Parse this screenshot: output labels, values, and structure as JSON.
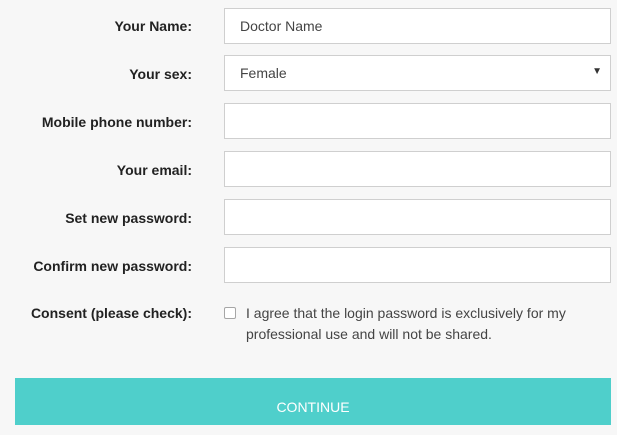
{
  "form": {
    "name": {
      "label": "Your Name:",
      "value": "Doctor Name"
    },
    "sex": {
      "label": "Your sex:",
      "value": "Female"
    },
    "mobile": {
      "label": "Mobile phone number:",
      "value": ""
    },
    "email": {
      "label": "Your email:",
      "value": ""
    },
    "new_password": {
      "label": "Set new password:",
      "value": ""
    },
    "confirm_password": {
      "label": "Confirm new password:",
      "value": ""
    },
    "consent": {
      "label": "Consent (please check):",
      "text": "I agree that the login password is exclusively for my professional use and will not be shared.",
      "checked": false
    },
    "continue_label": "CONTINUE"
  },
  "icons": {
    "select_caret": "chevron-down-icon"
  },
  "colors": {
    "button_bg": "#4fcfcb",
    "page_bg": "#f7f7f7"
  }
}
